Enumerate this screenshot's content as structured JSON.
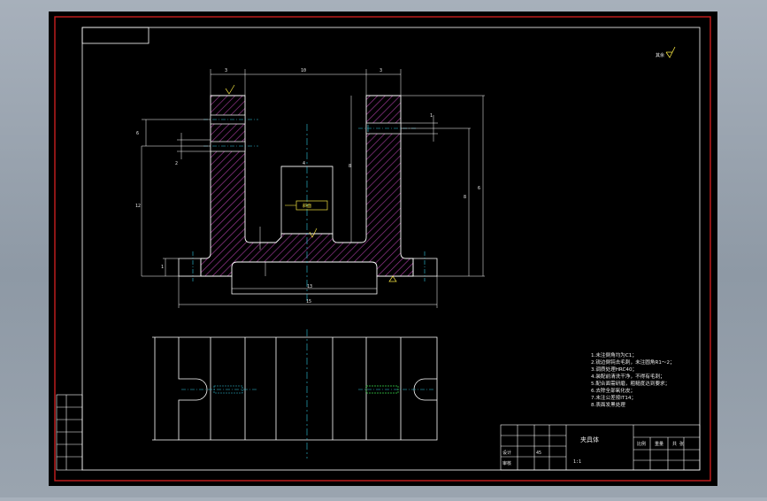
{
  "colors": {
    "background": "#8f9aa6",
    "drawing_area": "#000000",
    "border_red": "#c81e1e",
    "lines": "#ffffff",
    "hatch": "#a23a9a",
    "center_lines": "#2ec6e0",
    "thread_green": "#39d84a",
    "marker_yellow": "#f0e040"
  },
  "roughness_mark": {
    "label": "其余"
  },
  "dimensions": {
    "top_left_width": "3",
    "top_mid_width": "10",
    "top_right_width": "3",
    "left_upper": "6",
    "left_lower": "2",
    "left_height": "12",
    "slot_width": "4",
    "slot_depth": "8",
    "right_small": "1",
    "right_mid": "8",
    "right_outer": "6",
    "bottom_inner": "13",
    "bottom_outer": "15",
    "left_base": "1"
  },
  "yellow_tag": {
    "label": "斜面"
  },
  "technical_notes": [
    "1.未注倒角均为C1；",
    "2.锐边倒钝去毛刺，未注圆角R1～2；",
    "3.调质处理HRC40；",
    "4.装配前清洗干净，不得有毛刺；",
    "5.配合面需研磨，粗糙度达到要求；",
    "6.去除全部氧化皮；",
    "7.未注公差按IT14；",
    "8.表面发黑处理"
  ],
  "title_block": {
    "part_name": "夹具体",
    "designer_label": "设计",
    "check_label": "审核",
    "scale_label": "比例",
    "weight_label": "重量",
    "sheet_label": "共 张",
    "material": "45",
    "scale_value": "1:1"
  }
}
